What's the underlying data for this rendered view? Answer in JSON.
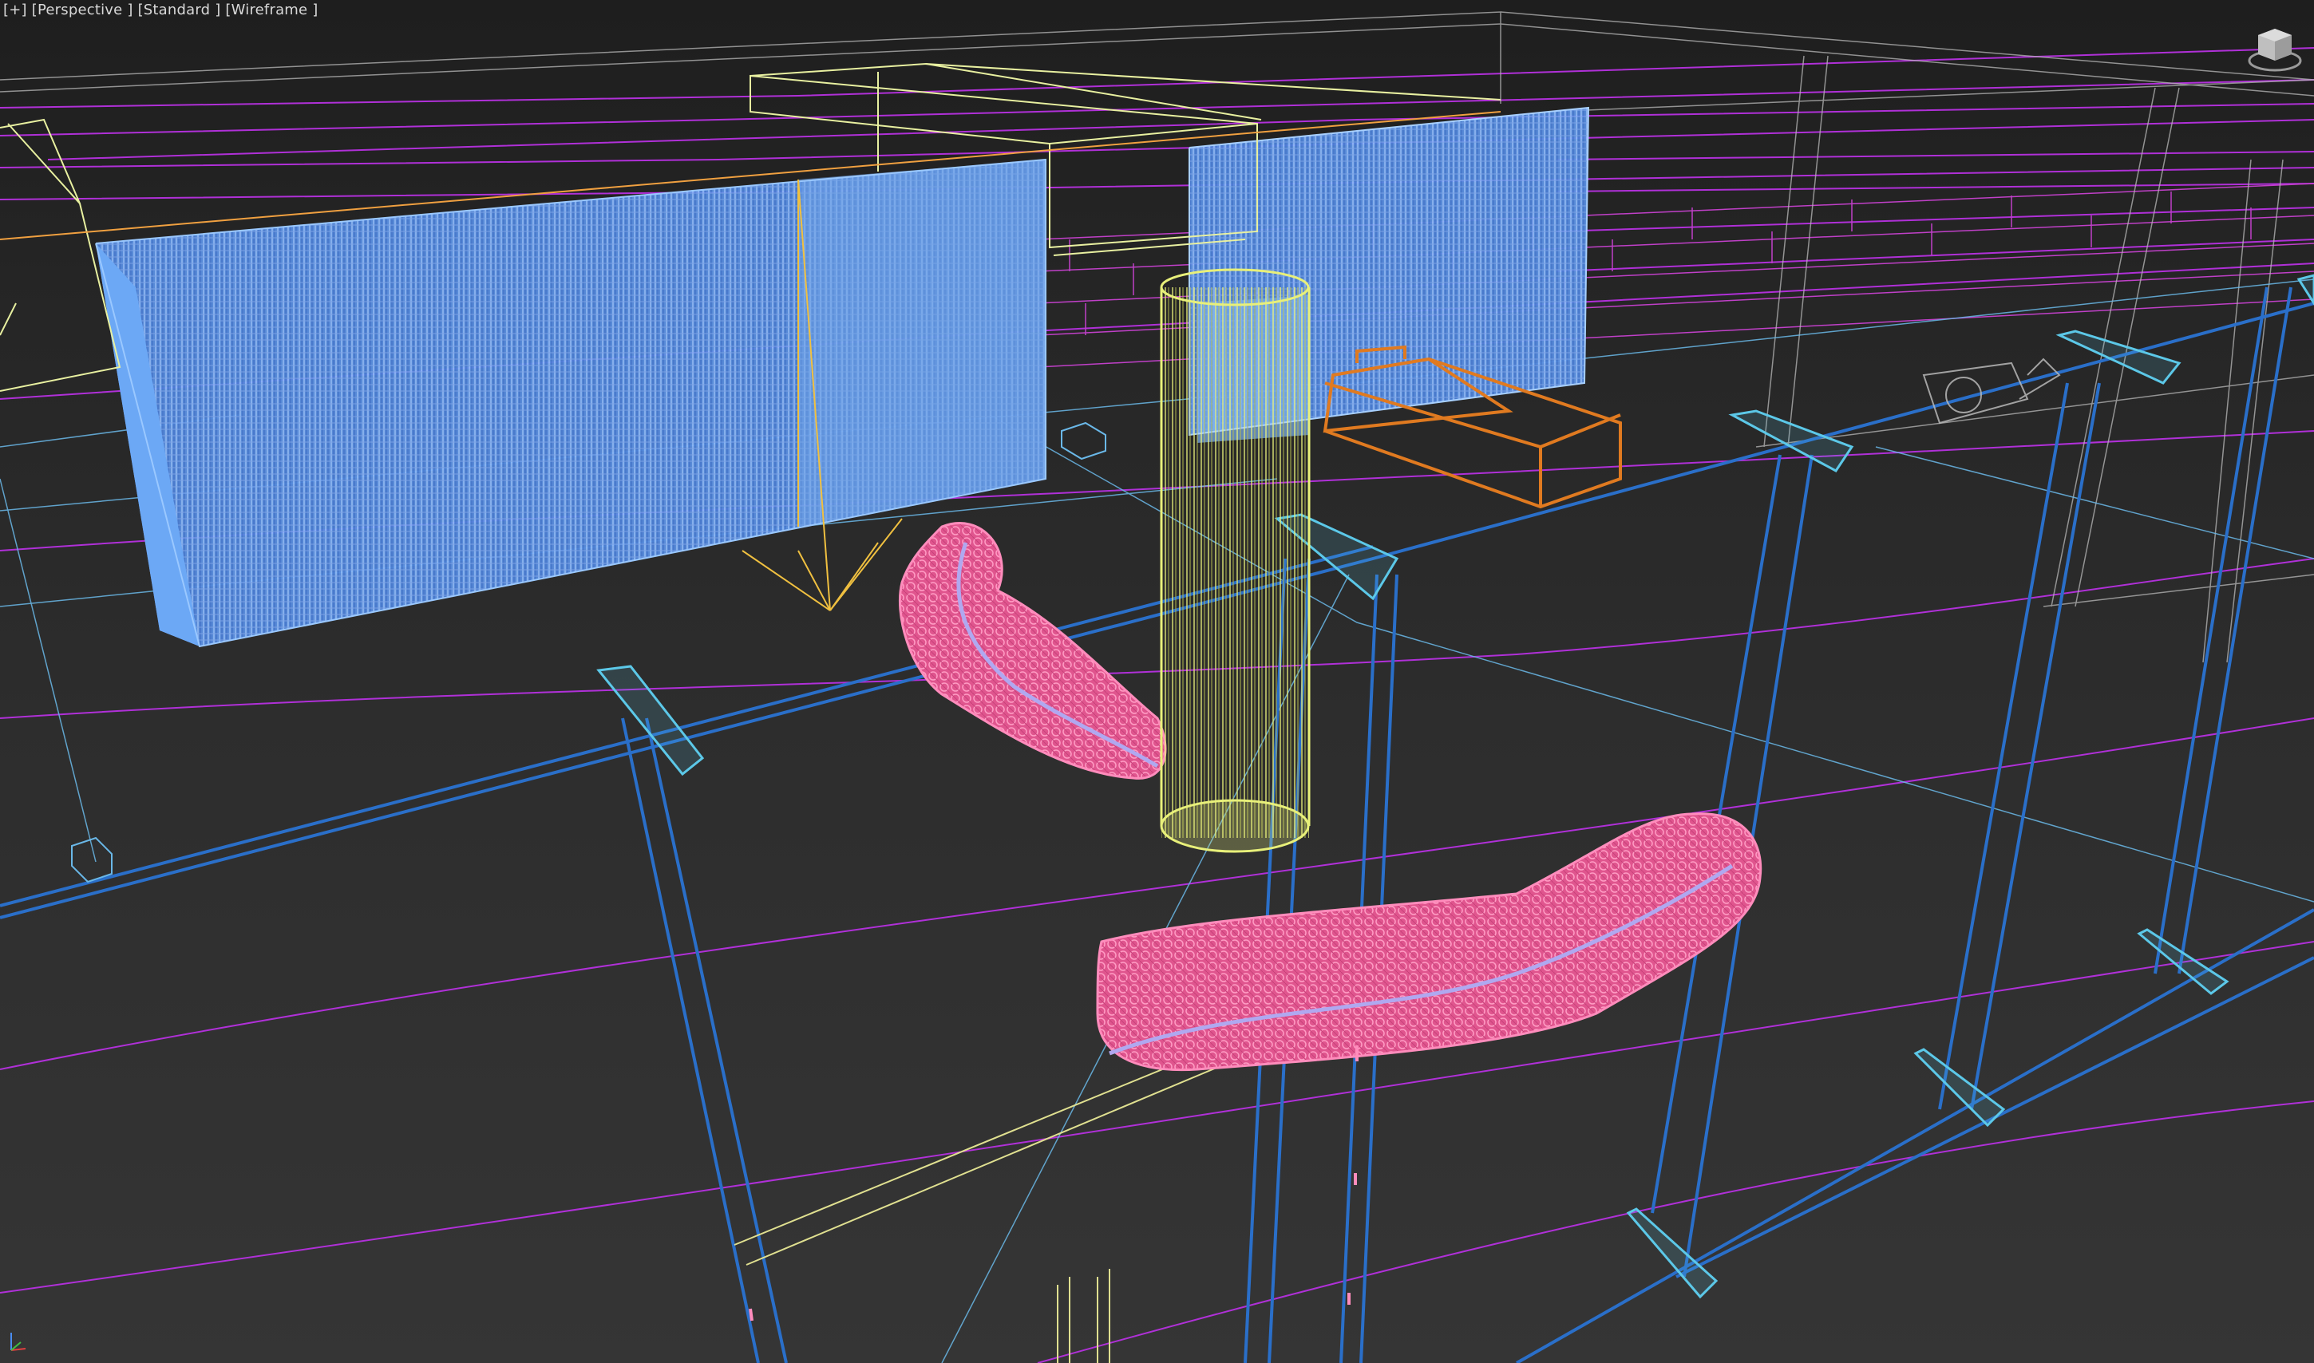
{
  "viewport": {
    "label_menu": "[+]",
    "label_view": "[Perspective ]",
    "label_shading_style": "[Standard ]",
    "label_display_mode": "[Wireframe ]"
  },
  "icons": {
    "viewcube": "viewcube-icon",
    "axis": "axis-tripod-icon"
  },
  "colors": {
    "background": "#2b2b2b",
    "label_text": "#d8d8d8",
    "grid_magenta": "#b030d8",
    "beam_blue": "#2a6fc9",
    "bracket_cyan": "#5cc8e8",
    "blob_pink": "#ff6fa8",
    "cylinder_yellow": "#e0ea70",
    "bench_orange": "#e07a20",
    "box_yellow": "#e8f0a0"
  },
  "scene_objects": [
    "blue-wall-block-left",
    "blue-wall-block-right",
    "yellow-cylinder",
    "pink-blob-upper",
    "pink-blob-lower",
    "orange-bench",
    "yellow-light-rig",
    "camera-object"
  ]
}
